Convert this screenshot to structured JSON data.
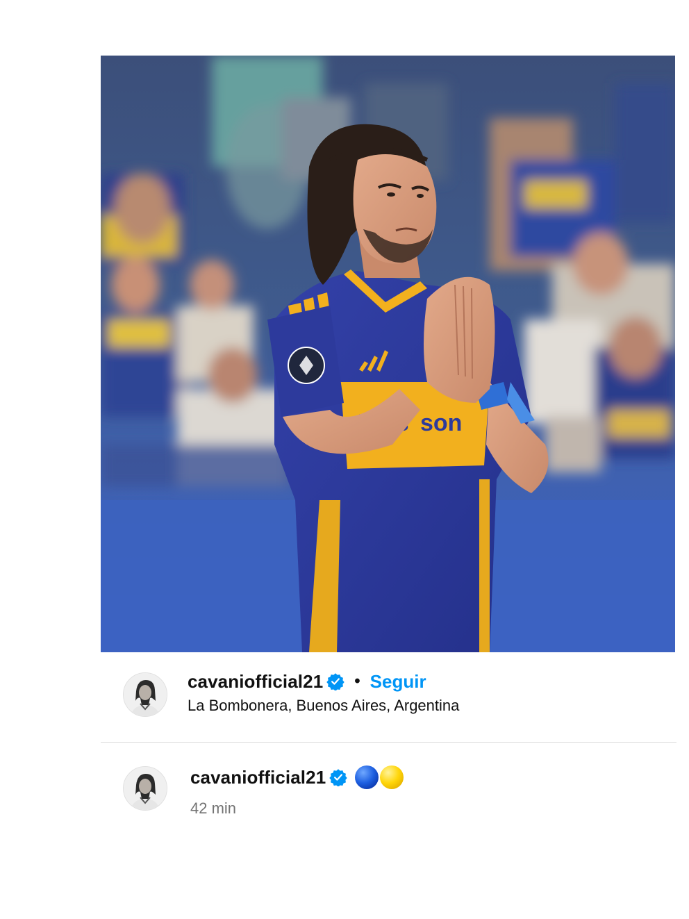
{
  "post": {
    "image": {
      "icon": "football-player-photo",
      "description_icon": "player-praying-hands-photo"
    },
    "header": {
      "username": "cavaniofficial21",
      "verified_icon": "verified-badge-icon",
      "separator": "•",
      "follow_label": "Seguir",
      "location": "La Bombonera, Buenos Aires, Argentina"
    },
    "caption": {
      "username": "cavaniofficial21",
      "verified_icon": "verified-badge-icon",
      "emojis": [
        "blue-circle-emoji",
        "yellow-circle-emoji"
      ],
      "time": "42 min"
    }
  },
  "colors": {
    "follow_blue": "#0095f6",
    "verified_blue": "#0095f6",
    "muted_text": "#737373",
    "divider": "#dbdbdb",
    "jersey_blue": "#2d3a9c",
    "jersey_gold": "#f2b01e"
  }
}
